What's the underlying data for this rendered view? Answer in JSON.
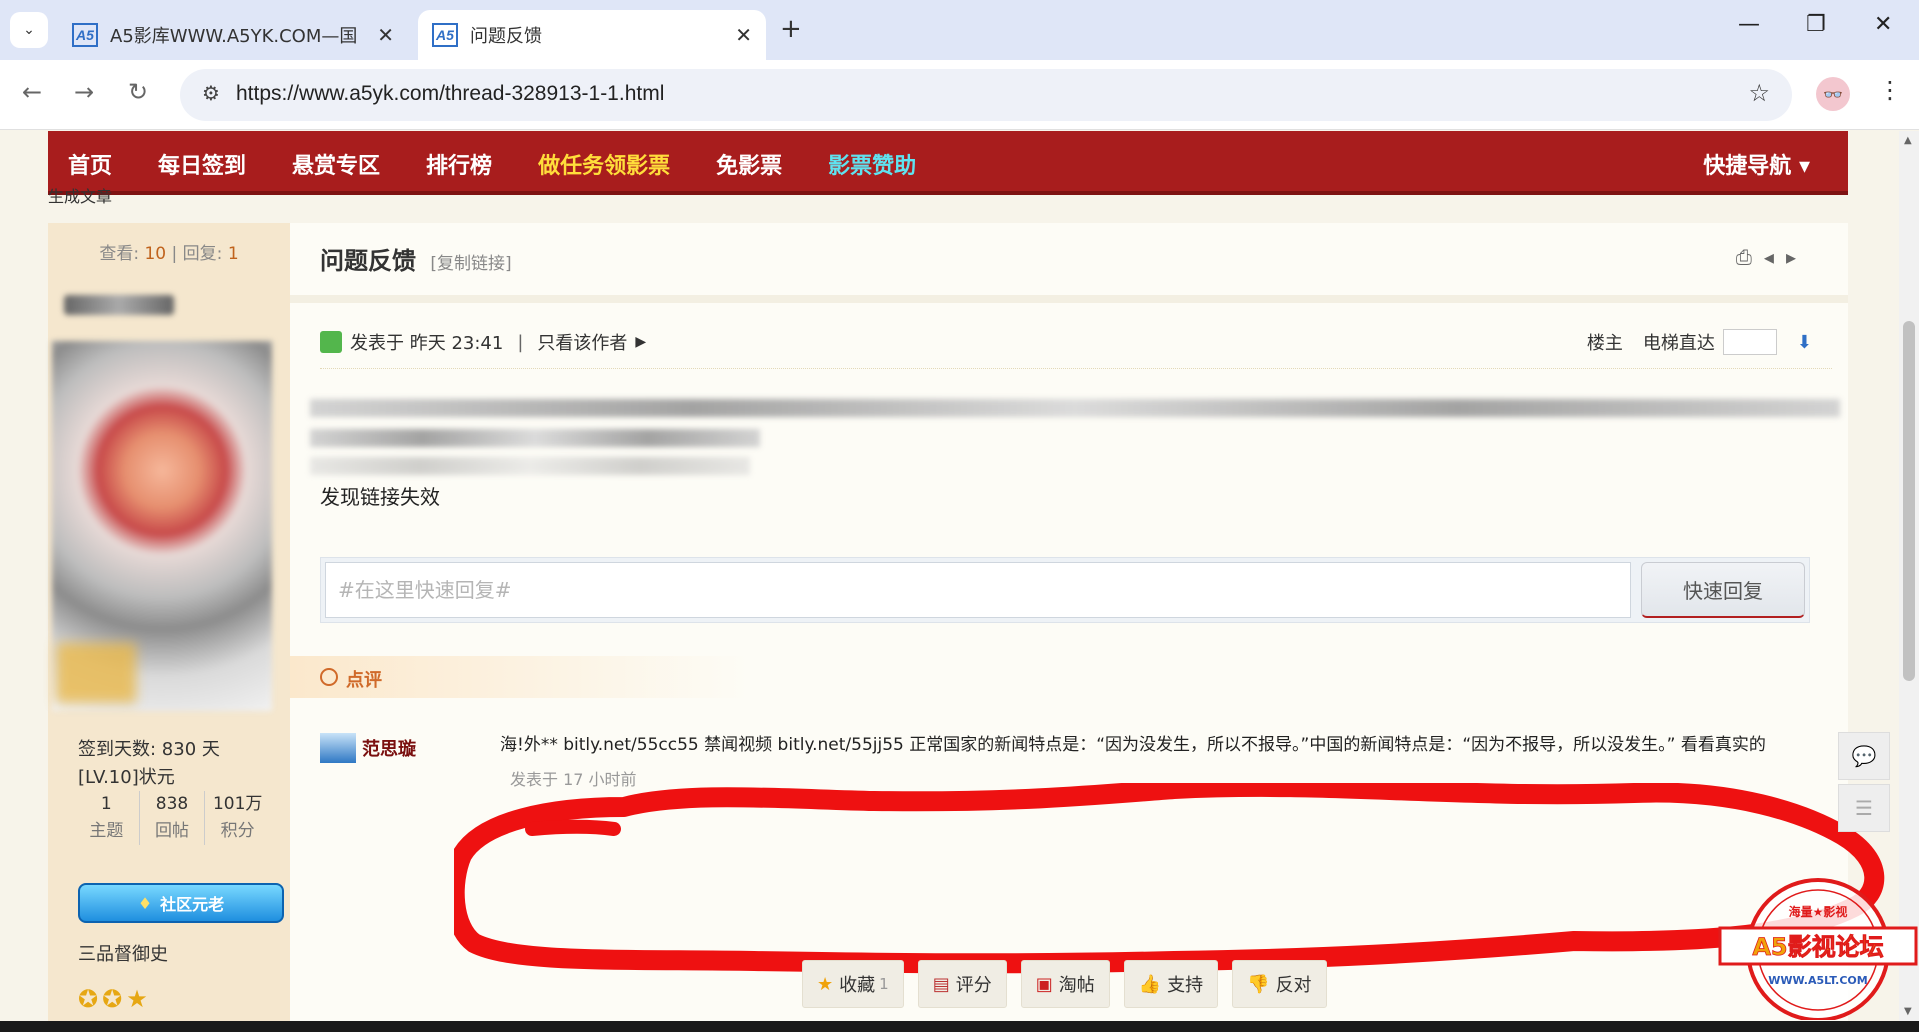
{
  "browser": {
    "tabs": [
      {
        "title": "A5影库WWW.A5YK.COM—国",
        "favicon": "A5",
        "active": false
      },
      {
        "title": "问题反馈",
        "favicon": "A5",
        "active": true
      }
    ],
    "new_tab": "+",
    "url": "https://www.a5yk.com/thread-328913-1-1.html",
    "window_controls": {
      "minimize": "—",
      "restore": "❐",
      "close": "✕"
    }
  },
  "nav": {
    "items": [
      "首页",
      "每日签到",
      "悬赏专区",
      "排行榜",
      "做任务领影票",
      "免影票",
      "影票赞助"
    ],
    "quick_nav": "快捷导航",
    "gen_article": "生成文章"
  },
  "sidebar": {
    "views_label": "查看:",
    "views": "10",
    "replies_label": "回复:",
    "replies": "1",
    "checkin": "签到天数: 830 天",
    "level": "[LV.10]状元",
    "counts": [
      {
        "value": "1",
        "label": "主题"
      },
      {
        "value": "838",
        "label": "回帖"
      },
      {
        "value": "101万",
        "label": "积分"
      }
    ],
    "medal": "社区元老",
    "rank_title": "三品督御史",
    "score_label": "积分",
    "score_value": "1019367"
  },
  "thread": {
    "title": "问题反馈",
    "copy_link": "[复制链接]",
    "posted": "发表于 昨天 23:41",
    "separator": "|",
    "author_only": "只看该作者",
    "floor_owner": "楼主",
    "elevator": "电梯直达",
    "body": "发现链接失效"
  },
  "quick_reply": {
    "placeholder": "#在这里快速回复#",
    "button": "快速回复"
  },
  "comments": {
    "header": "点评",
    "items": [
      {
        "author": "范思璇",
        "text": "海!外** bitly.net/55cc55 禁闻视频 bitly.net/55jj55 正常国家的新闻特点是：“因为没发生，所以不报导。”中国的新闻特点是：“因为不报导，所以没发生。” 看看真实的",
        "time": "发表于 17 小时前"
      }
    ]
  },
  "actions": [
    {
      "label": "收藏",
      "count": "1",
      "icon": "star-icon"
    },
    {
      "label": "评分",
      "count": "",
      "icon": "calendar-icon"
    },
    {
      "label": "淘帖",
      "count": "",
      "icon": "box-icon"
    },
    {
      "label": "支持",
      "count": "",
      "icon": "thumb-up-icon"
    },
    {
      "label": "反对",
      "count": "",
      "icon": "thumb-down-icon"
    }
  ],
  "watermark": {
    "main": "A5影视论坛",
    "top": "海量★影视",
    "url": "WWW.A5LT.COM"
  },
  "colors": {
    "nav_red": "#a81d1d",
    "nav_yellow": "#ffde3b",
    "nav_cyan": "#5fe3f0",
    "annotation_red": "#ee1111"
  }
}
